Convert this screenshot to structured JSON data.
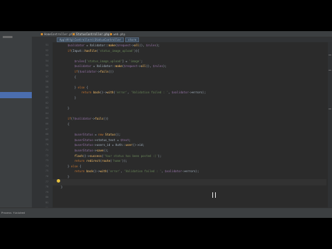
{
  "tabs": [
    {
      "label": "HomeController.php",
      "active": false
    },
    {
      "label": "StatusController.php",
      "active": true
    },
    {
      "label": "web.php",
      "active": false
    }
  ],
  "breadcrumb": [
    "App\\Http\\Controllers\\StatusController",
    "store"
  ],
  "line_numbers": [
    "51",
    "52",
    "53",
    "54",
    "55",
    "56",
    "57",
    "58",
    "59",
    "60",
    "61",
    "62",
    "63",
    "64",
    "65",
    "66",
    "67",
    "68",
    "69",
    "70",
    "71",
    "72",
    "73",
    "74",
    "75",
    "76",
    "77",
    "78",
    "79",
    "80",
    "81",
    "82"
  ],
  "code_lines": [
    "        $validator = Validator::make($request->all(), $rules);",
    "        if(Input::hasFile('status_image_upload')){",
    "",
    "            $rules['status_image_upload'] = 'image';",
    "            $validator = Validator::make($request->all(), $rules);",
    "            if($validator->fails())",
    "            {",
    "",
    "            } else {",
    "                return back()->with('error', 'Validation failed : ', $validator->errors);",
    "            }",
    "",
    "        }",
    "",
    "        if(!$validator->fails())",
    "        {",
    "",
    "            $userStatus = new Status();",
    "            $userStatus->status_text = $text;",
    "            $userStatus->users_id = Auth::user()->id;",
    "            $userStatus->save();",
    "            flash()->success('Your status has been posted :)');",
    "            return redirect(route('home'));",
    "        } else {",
    "            return back()->with('error', 'Validation failed : ', $validator->errors);",
    "        }",
    "",
    "    }",
    "",
    "",
    "",
    ""
  ],
  "status_bar": {
    "text": "Process finished"
  },
  "colors": {
    "keyword": "#cc7832",
    "string": "#6a8759",
    "variable": "#9876aa",
    "function": "#ffc66d",
    "background": "#2b2b2b"
  }
}
